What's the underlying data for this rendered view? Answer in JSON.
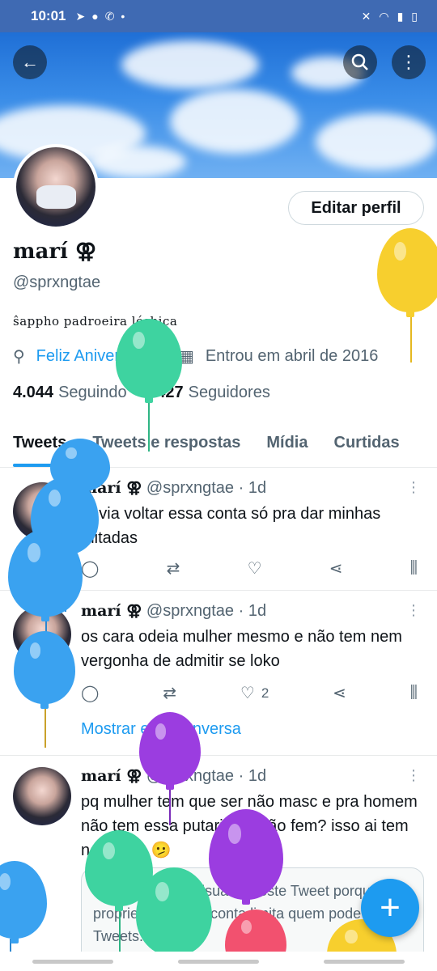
{
  "status_bar": {
    "time": "10:01"
  },
  "profile": {
    "name": "marí ⚢",
    "handle": "@sprxngtae",
    "bio": "ŝappho padroeira lésbica",
    "birthday": "Feliz Aniversário!",
    "joined": "Entrou em abril de 2016",
    "following_count": "4.044",
    "following_label": "Seguindo",
    "followers_count": "7.427",
    "followers_label": "Seguidores",
    "edit_label": "Editar perfil"
  },
  "tabs": [
    {
      "label": "Tweets"
    },
    {
      "label": "Tweets e respostas"
    },
    {
      "label": "Mídia"
    },
    {
      "label": "Curtidas"
    }
  ],
  "tweets": [
    {
      "name": "marí ⚢",
      "handle": "@sprxngtae",
      "time": "· 1d",
      "text": "devia voltar essa conta só pra dar minhas mitadas",
      "likes": ""
    },
    {
      "name": "marí ⚢",
      "handle": "@sprxngtae",
      "time": "· 1d",
      "text": "os cara odeia mulher mesmo e não tem nem vergonha de admitir se loko",
      "likes": "2",
      "show_conversation": "Mostrar esta conversa"
    },
    {
      "name": "marí ⚢",
      "handle": "@sprxngtae",
      "time": "· 1d",
      "text": "pq mulher tem que ser não masc e pra homem não tem essa putaria de não fem? isso ai tem nome viu 🫤",
      "withheld": "Você não pode visualizar este Tweet porque o proprietário desta conta limita quem pode ver os Tweets. Saiba"
    }
  ],
  "icons": {
    "back": "back-arrow-icon",
    "search": "search-icon",
    "more": "more-vertical-icon",
    "balloon": "balloon-icon",
    "calendar": "calendar-icon",
    "compose": "compose-plus-icon"
  },
  "colors": {
    "accent": "#1d9bf0",
    "status_bar": "#3f6ab3",
    "balloon_blue": "#3aa2f0",
    "balloon_green": "#3ed3a0",
    "balloon_purple": "#9b3de0",
    "balloon_yellow": "#f7cf2e",
    "balloon_pink": "#f2516f"
  }
}
